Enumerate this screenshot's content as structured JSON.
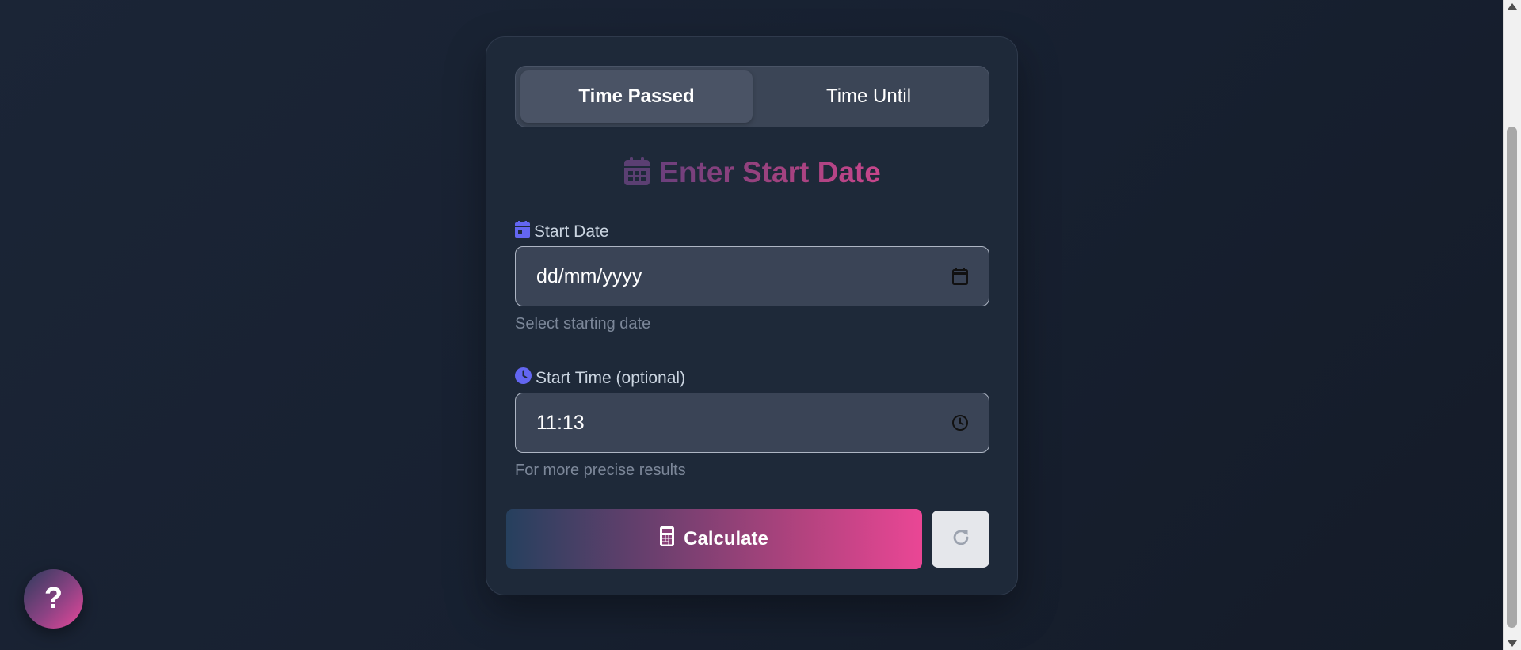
{
  "tabs": [
    {
      "label": "Time Passed",
      "active": true
    },
    {
      "label": "Time Until",
      "active": false
    }
  ],
  "heading": {
    "text": "Enter Start Date",
    "icon": "calendar-icon"
  },
  "start_date": {
    "label": "Start Date",
    "label_icon": "calendar-event-icon",
    "value": "dd/mm/yyyy",
    "picker_icon": "calendar-picker-icon",
    "hint": "Select starting date"
  },
  "start_time": {
    "label": "Start Time (optional)",
    "label_icon": "clock-icon",
    "value": "11:13",
    "picker_icon": "clock-picker-icon",
    "hint": "For more precise results"
  },
  "actions": {
    "calculate_label": "Calculate",
    "calculate_icon": "calculator-icon",
    "reset_icon": "refresh-icon"
  },
  "help": {
    "label": "?"
  },
  "colors": {
    "accent_purple": "#6366f1",
    "accent_pink": "#ec4899",
    "card_bg": "#1e2939",
    "input_bg": "#3a4456"
  }
}
